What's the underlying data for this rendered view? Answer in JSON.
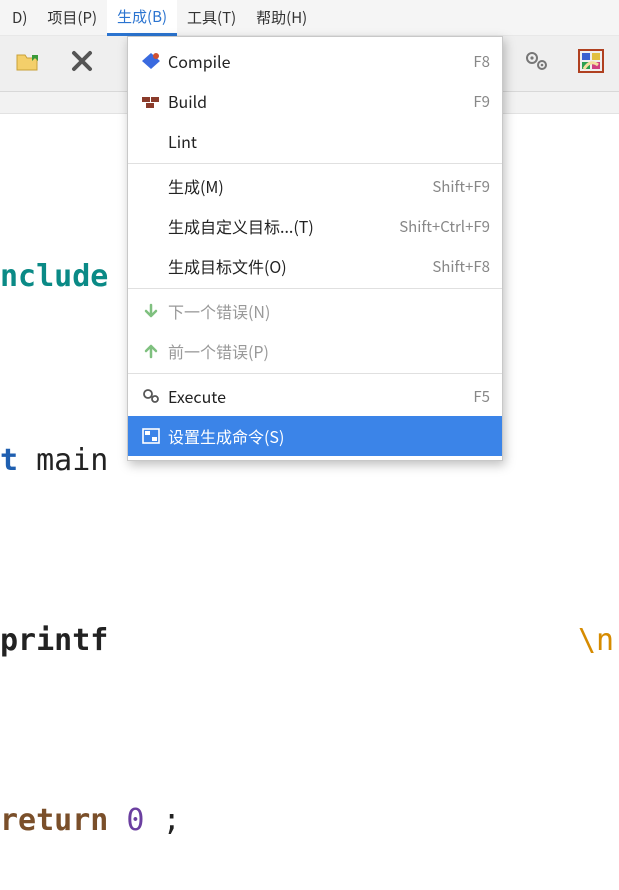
{
  "menubar": {
    "items": [
      {
        "label": "D)"
      },
      {
        "label": "项目(P)"
      },
      {
        "label": "生成(B)"
      },
      {
        "label": "工具(T)"
      },
      {
        "label": "帮助(H)"
      }
    ],
    "active_index": 2
  },
  "dropdown": {
    "items": [
      {
        "type": "item",
        "icon": "compile-icon",
        "label": "Compile",
        "accel": "F8"
      },
      {
        "type": "item",
        "icon": "build-icon",
        "label": "Build",
        "accel": "F9"
      },
      {
        "type": "item",
        "icon": "",
        "label": "Lint",
        "accel": ""
      },
      {
        "type": "sep"
      },
      {
        "type": "item",
        "icon": "",
        "label": "生成(M)",
        "accel": "Shift+F9"
      },
      {
        "type": "item",
        "icon": "",
        "label": "生成自定义目标...(T)",
        "accel": "Shift+Ctrl+F9"
      },
      {
        "type": "item",
        "icon": "",
        "label": "生成目标文件(O)",
        "accel": "Shift+F8"
      },
      {
        "type": "sep"
      },
      {
        "type": "item",
        "icon": "arrow-down-icon",
        "label": "下一个错误(N)",
        "accel": "",
        "disabled": true
      },
      {
        "type": "item",
        "icon": "arrow-up-icon",
        "label": "前一个错误(P)",
        "accel": "",
        "disabled": true
      },
      {
        "type": "sep"
      },
      {
        "type": "item",
        "icon": "gears-icon",
        "label": "Execute",
        "accel": "F5"
      },
      {
        "type": "item",
        "icon": "panel-icon",
        "label": "设置生成命令(S)",
        "accel": "",
        "selected": true
      }
    ]
  },
  "editor": {
    "l1_pp": "nclude",
    "l2_kw": "t",
    "l2_id": " main",
    "l3_fn": "printf",
    "l3_str": "\\n\")",
    "l3_sc": " ;",
    "l4_kw": "return",
    "l4_num": " 0 ",
    "l4_sc": ";"
  }
}
